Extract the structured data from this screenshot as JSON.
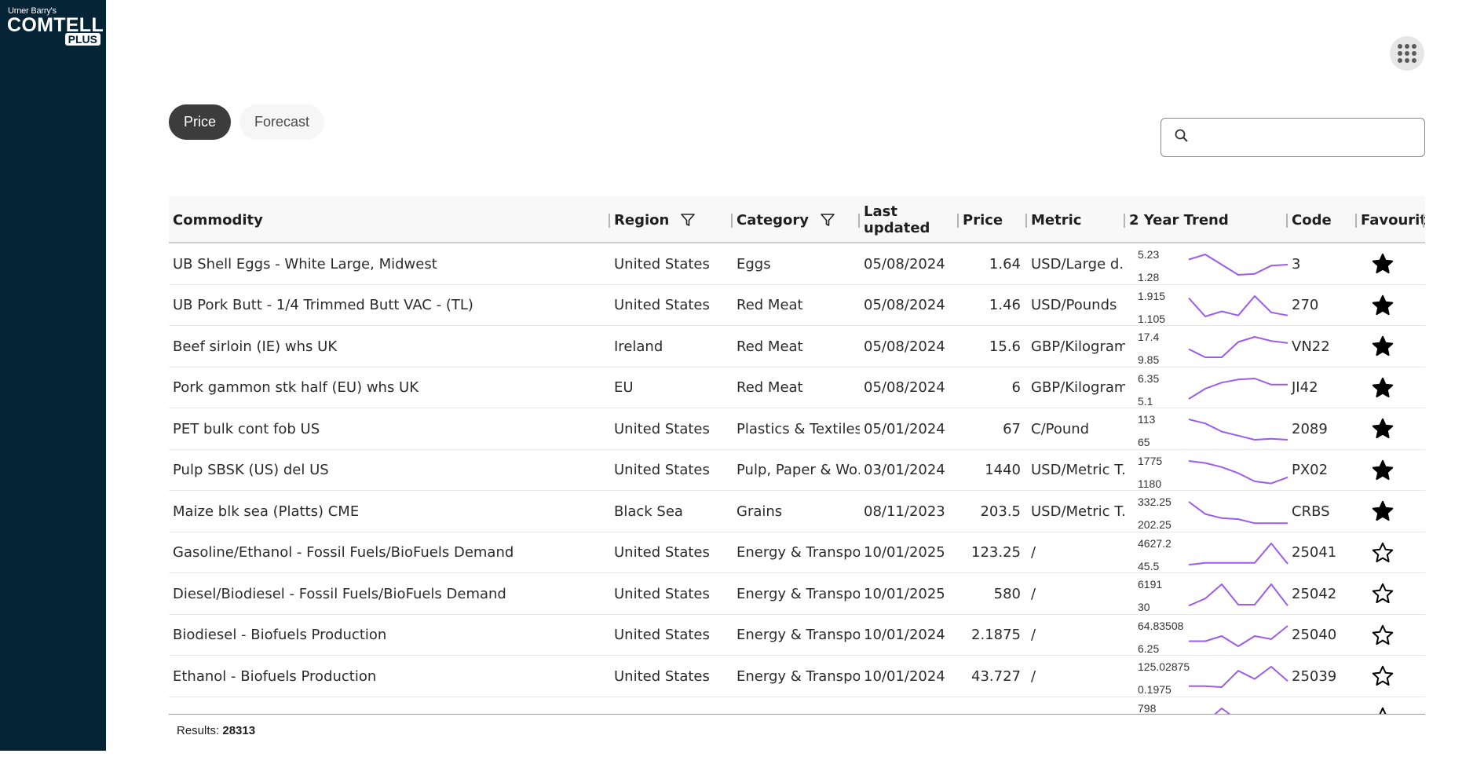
{
  "logo": {
    "small": "Urner Barry's",
    "big": "COMTELL",
    "plus": "PLUS"
  },
  "tabs": [
    {
      "label": "Price",
      "active": true
    },
    {
      "label": "Forecast",
      "active": false
    }
  ],
  "search": {
    "value": "",
    "placeholder": ""
  },
  "table": {
    "columns": {
      "commodity": "Commodity",
      "region": "Region",
      "category": "Category",
      "updated": "Last updated",
      "price": "Price",
      "metric": "Metric",
      "trend": "2 Year Trend",
      "code": "Code",
      "favourite": "Favourite"
    },
    "rows": [
      {
        "commodity": "UB Shell Eggs - White Large, Midwest",
        "region": "United States",
        "category": "Eggs",
        "updated": "05/08/2024",
        "price": "1.64",
        "metric": "USD/Large d...",
        "max": "5.23",
        "min": "1.28",
        "trend": [
          0.25,
          0.0,
          0.5,
          1.0,
          0.95,
          0.55,
          0.5
        ],
        "code": "3",
        "favourite": true
      },
      {
        "commodity": "UB Pork Butt - 1/4 Trimmed Butt VAC - (TL)",
        "region": "United States",
        "category": "Red Meat",
        "updated": "05/08/2024",
        "price": "1.46",
        "metric": "USD/Pounds",
        "max": "1.915",
        "min": "1.105",
        "trend": [
          0.1,
          1.0,
          0.75,
          0.95,
          0.0,
          0.8,
          0.95
        ],
        "code": "270",
        "favourite": true
      },
      {
        "commodity": "Beef sirloin (IE) whs UK",
        "region": "Ireland",
        "category": "Red Meat",
        "updated": "05/08/2024",
        "price": "15.6",
        "metric": "GBP/Kilogram",
        "max": "17.4",
        "min": "9.85",
        "trend": [
          0.6,
          1.0,
          1.0,
          0.25,
          0.0,
          0.2,
          0.3
        ],
        "code": "VN22",
        "favourite": true
      },
      {
        "commodity": "Pork gammon stk half (EU) whs UK",
        "region": "EU",
        "category": "Red Meat",
        "updated": "05/08/2024",
        "price": "6",
        "metric": "GBP/Kilogram",
        "max": "6.35",
        "min": "5.1",
        "trend": [
          1.0,
          0.5,
          0.2,
          0.05,
          0.0,
          0.3,
          0.3
        ],
        "code": "JI42",
        "favourite": true
      },
      {
        "commodity": "PET bulk cont fob US",
        "region": "United States",
        "category": "Plastics & Textiles",
        "updated": "05/01/2024",
        "price": "67",
        "metric": "C/Pound",
        "max": "113",
        "min": "65",
        "trend": [
          0.0,
          0.2,
          0.6,
          0.8,
          1.0,
          0.95,
          1.0
        ],
        "code": "2089",
        "favourite": true
      },
      {
        "commodity": "Pulp SBSK (US) del US",
        "region": "United States",
        "category": "Pulp, Paper & Wo...",
        "updated": "03/01/2024",
        "price": "1440",
        "metric": "USD/Metric T...",
        "max": "1775",
        "min": "1180",
        "trend": [
          0.0,
          0.1,
          0.3,
          0.6,
          1.0,
          1.1,
          0.8
        ],
        "code": "PX02",
        "favourite": true
      },
      {
        "commodity": "Maize blk sea (Platts) CME",
        "region": "Black Sea",
        "category": "Grains",
        "updated": "08/11/2023",
        "price": "203.5",
        "metric": "USD/Metric T...",
        "max": "332.25",
        "min": "202.25",
        "trend": [
          0.0,
          0.6,
          0.8,
          0.85,
          1.05,
          1.05,
          1.05
        ],
        "code": "CRBS",
        "favourite": true
      },
      {
        "commodity": "Gasoline/Ethanol - Fossil Fuels/BioFuels Demand",
        "region": "United States",
        "category": "Energy & Transport",
        "updated": "10/01/2025",
        "price": "123.25",
        "metric": "/",
        "max": "4627.2",
        "min": "45.5",
        "trend": [
          1.05,
          0.95,
          0.95,
          0.95,
          0.95,
          0.0,
          1.0
        ],
        "code": "25041",
        "favourite": false
      },
      {
        "commodity": "Diesel/Biodiesel - Fossil Fuels/BioFuels Demand",
        "region": "United States",
        "category": "Energy & Transport",
        "updated": "10/01/2025",
        "price": "580",
        "metric": "/",
        "max": "6191",
        "min": "30",
        "trend": [
          1.05,
          0.7,
          0.0,
          1.0,
          1.0,
          0.0,
          1.05
        ],
        "code": "25042",
        "favourite": false
      },
      {
        "commodity": "Biodiesel - Biofuels Production",
        "region": "United States",
        "category": "Energy & Transport",
        "updated": "10/01/2024",
        "price": "2.1875",
        "metric": "/",
        "max": "64.83508",
        "min": "6.25",
        "trend": [
          0.75,
          0.75,
          0.5,
          1.0,
          0.5,
          0.65,
          0.0
        ],
        "code": "25040",
        "favourite": false
      },
      {
        "commodity": "Ethanol - Biofuels Production",
        "region": "United States",
        "category": "Energy & Transport",
        "updated": "10/01/2024",
        "price": "43.727",
        "metric": "/",
        "max": "125.02875",
        "min": "0.1975",
        "trend": [
          0.95,
          0.95,
          1.0,
          0.2,
          0.6,
          0.0,
          0.7
        ],
        "code": "25039",
        "favourite": false
      },
      {
        "commodity": "",
        "region": "",
        "category": "",
        "updated": "",
        "price": "",
        "metric": "",
        "max": "798",
        "min": "",
        "trend": [
          0.4,
          0.7,
          0.0,
          0.6,
          0.5,
          0.9,
          0.9
        ],
        "code": "",
        "favourite": false
      }
    ]
  },
  "footer": {
    "results_label": "Results:",
    "results_count": "28313"
  },
  "colors": {
    "sidebar": "#052436",
    "trend_line": "#9b5cf0",
    "active_tab": "#3c3c3c"
  }
}
